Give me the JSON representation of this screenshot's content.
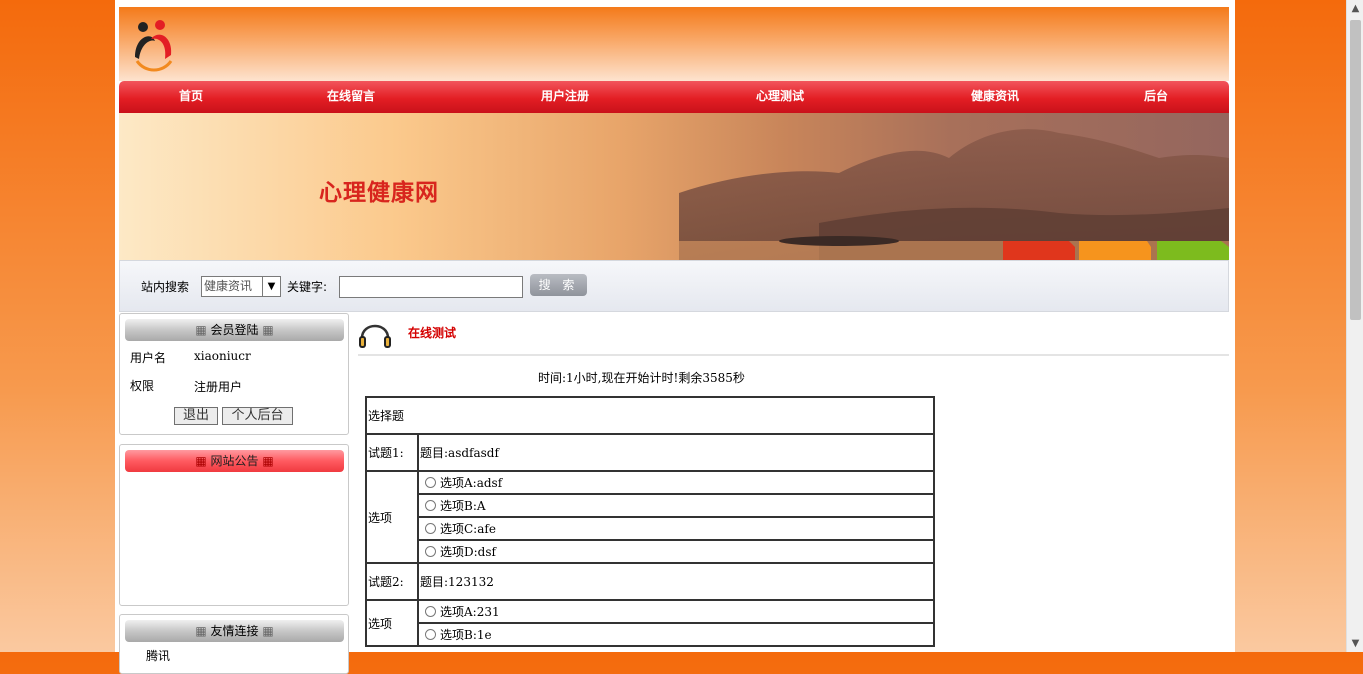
{
  "nav": {
    "items": [
      "首页",
      "在线留言",
      "用户注册",
      "心理测试",
      "健康资讯",
      "后台"
    ]
  },
  "banner": {
    "title": "心理健康网"
  },
  "search": {
    "label": "站内搜索",
    "category_value": "健康资讯",
    "keyword_label": "关键字:",
    "keyword_value": "",
    "button_label": "搜 索"
  },
  "member_box": {
    "title": "会员登陆",
    "username_label": "用户名",
    "username_value": "xiaoniucr",
    "role_label": "权限",
    "role_value": "注册用户",
    "logout_label": "退出",
    "personal_label": "个人后台"
  },
  "notice_box": {
    "title": "网站公告"
  },
  "links_box": {
    "title": "友情连接",
    "first_item": "腾讯"
  },
  "content": {
    "title": "在线测试",
    "timer_text": "时间:1小时,现在开始计时!剩余3585秒",
    "section_label": "选择题",
    "questions": [
      {
        "number_label": "试题1:",
        "text": "题目:asdfasdf",
        "options_label": "选项",
        "options": [
          "选项A:adsf",
          "选项B:A",
          "选项C:afe",
          "选项D:dsf"
        ]
      },
      {
        "number_label": "试题2:",
        "text": "题目:123132",
        "options_label": "选项",
        "options": [
          "选项A:231",
          "选项B:1e"
        ]
      }
    ]
  },
  "colors": {
    "nav_red": "#e31e24",
    "title_red": "#d40000",
    "banner_title": "#d8251e",
    "background_orange": "#f46a0c"
  }
}
